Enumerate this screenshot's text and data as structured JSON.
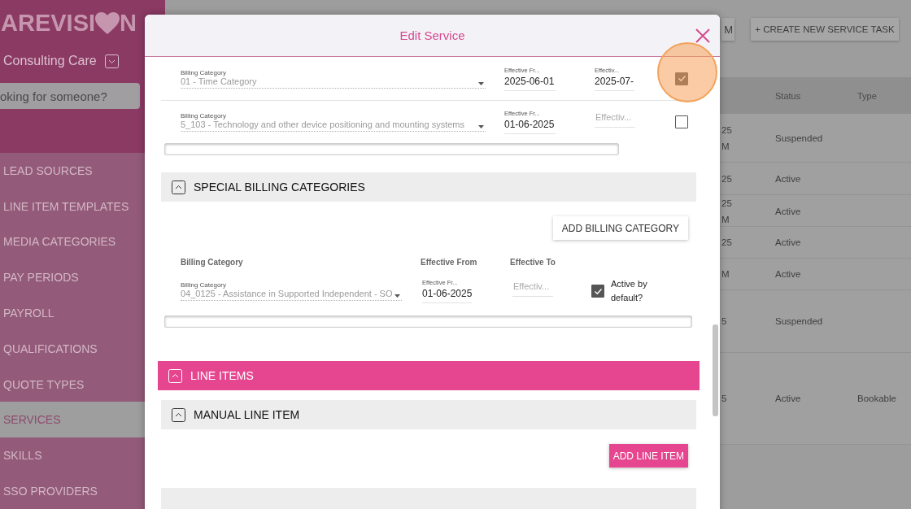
{
  "sidebar": {
    "logo": {
      "text_before": "AREVISI",
      "text_after": "N"
    },
    "organization": "Consulting Care",
    "search": {
      "placeholder": "oking for someone?"
    },
    "items": [
      {
        "label": "LEAD SOURCES",
        "selected": false
      },
      {
        "label": "LINE ITEM TEMPLATES",
        "selected": false
      },
      {
        "label": "MEDIA CATEGORIES",
        "selected": false
      },
      {
        "label": "PAY PERIODS",
        "selected": false
      },
      {
        "label": "PAYROLL",
        "selected": false
      },
      {
        "label": "QUALIFICATIONS",
        "selected": false
      },
      {
        "label": "QUOTE TYPES",
        "selected": false
      },
      {
        "label": "SERVICES",
        "selected": true
      },
      {
        "label": "SKILLS",
        "selected": false
      },
      {
        "label": "SSO PROVIDERS",
        "selected": false
      }
    ]
  },
  "page": {
    "buttons": [
      "M",
      "+ CREATE NEW SERVICE TASK"
    ],
    "table": {
      "columns": [
        "Status",
        "Type"
      ],
      "rows": [
        {
          "column_1": [
            "25",
            "M"
          ],
          "status": "Suspended"
        },
        {
          "column_1": [
            "25"
          ],
          "status": "Active"
        },
        {
          "column_1": [
            "25",
            "M"
          ],
          "status": "Active"
        },
        {
          "column_1": [
            "25"
          ],
          "status": "Active"
        },
        {
          "column_1": [
            "M"
          ],
          "status": "Active"
        },
        {
          "column_1": [
            "5"
          ],
          "status": "Suspended"
        },
        {
          "column_1": [
            "5"
          ],
          "status": "Active",
          "type": "Bookable"
        }
      ]
    }
  },
  "modal": {
    "title": "Edit Service",
    "billing_rows": [
      {
        "field_label": "Billing Category",
        "category": "01 - Time Category",
        "from_label": "Effective Fr...",
        "from": "2025-06-01",
        "to_label": "Effectiv...",
        "to": "2025-07-",
        "checked": true,
        "highlighted": true
      },
      {
        "field_label": "Billing Category",
        "category": "5_103 - Technology and other device positioning and mounting systems",
        "from_label": "Effective Fr...",
        "from": "01-06-2025",
        "to_placeholder": "Effectiv...",
        "checked": false
      }
    ],
    "special": {
      "header": {
        "title": "SPECIAL BILLING CATEGORIES",
        "kind": "secondary"
      },
      "add_button": "ADD BILLING CATEGORY",
      "columns": [
        "Billing Category",
        "Effective From",
        "Effective To"
      ],
      "rows": [
        {
          "field_label": "Billing Category",
          "category": "04_0125 - Assistance in Supported Independent - SO",
          "from_label": "Effective Fr...",
          "from": "01-06-2025",
          "to_placeholder": "Effectiv...",
          "active": true,
          "active_label": "Active by default?"
        }
      ]
    },
    "line_items": {
      "header": {
        "title": "LINE ITEMS",
        "kind": "primary"
      },
      "manual_header": {
        "title": "MANUAL LINE ITEM",
        "kind": "secondary"
      },
      "add_button": "ADD LINE ITEM",
      "next_header": {
        "kind": "secondary"
      }
    }
  }
}
